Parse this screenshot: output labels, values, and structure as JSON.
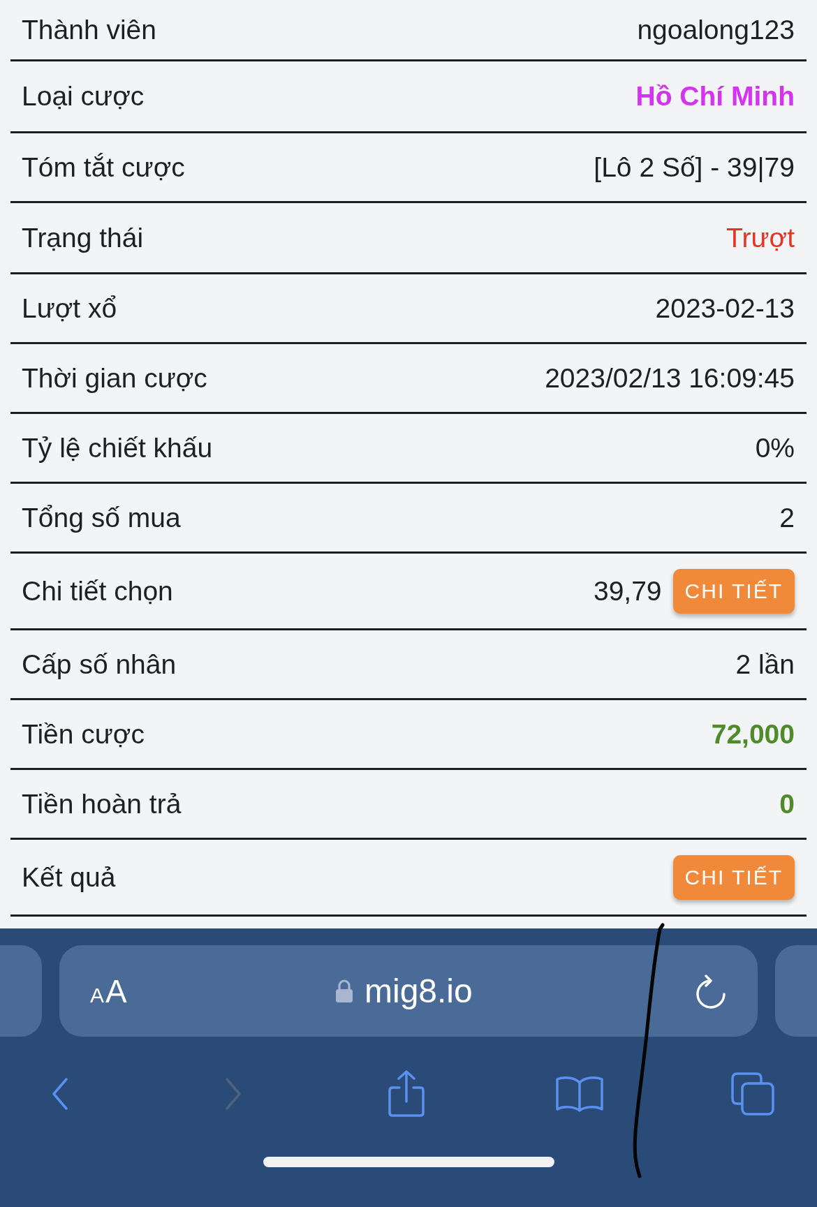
{
  "rows": [
    {
      "kind": "text",
      "label": "Thành viên",
      "value": "ngoalong123"
    },
    {
      "kind": "text",
      "label": "Loại cược",
      "value": "Hồ Chí Minh",
      "color": "#d433ef",
      "bold": true
    },
    {
      "kind": "text",
      "label": "Tóm tắt cược",
      "value": "[Lô 2 Số] - 39|79"
    },
    {
      "kind": "text",
      "label": "Trạng thái",
      "value": "Trượt",
      "color": "#e63323"
    },
    {
      "kind": "text",
      "label": "Lượt xổ",
      "value": "2023-02-13"
    },
    {
      "kind": "text",
      "label": "Thời gian cược",
      "value": "2023/02/13 16:09:45"
    },
    {
      "kind": "text",
      "label": "Tỷ lệ chiết khấu",
      "value": "0%"
    },
    {
      "kind": "text",
      "label": "Tổng số mua",
      "value": "2"
    },
    {
      "kind": "text_button",
      "label": "Chi tiết chọn",
      "value": "39,79",
      "button": "CHI TIẾT"
    },
    {
      "kind": "text",
      "label": "Cấp số nhân",
      "value": "2 lần"
    },
    {
      "kind": "text",
      "label": "Tiền cược",
      "value": "72,000",
      "color": "#4f8a2b",
      "bold": true
    },
    {
      "kind": "text",
      "label": "Tiền hoàn trả",
      "value": "0",
      "color": "#4f8a2b",
      "bold": true
    },
    {
      "kind": "button",
      "label": "Kết quả",
      "button": "CHI TIẾT"
    }
  ],
  "browser": {
    "format_button": [
      "A",
      "A"
    ],
    "secure": true,
    "address": "mig8.io",
    "toolbar": [
      {
        "kind": "back",
        "disabled": false
      },
      {
        "kind": "forward",
        "disabled": true
      },
      {
        "kind": "share",
        "disabled": false
      },
      {
        "kind": "bookmarks",
        "disabled": false
      },
      {
        "kind": "tabs",
        "disabled": false
      }
    ]
  }
}
